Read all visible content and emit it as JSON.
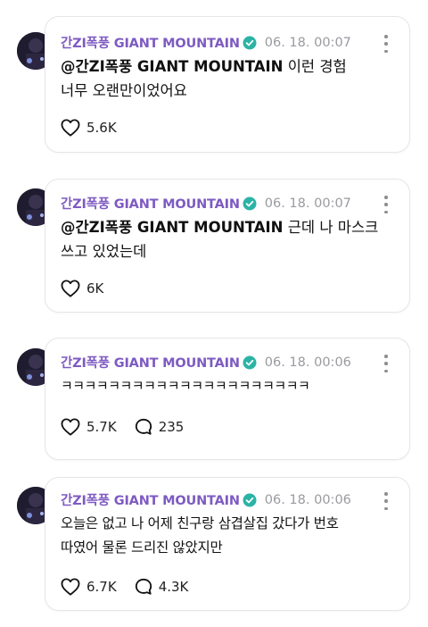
{
  "posts": [
    {
      "author": "간ZI폭풍 GIANT MOUNTAIN",
      "timestamp": "06. 18. 00:07",
      "mention": "@간ZI폭풍 GIANT MOUNTAIN",
      "text_line1": " 이런 경험",
      "text_line2": "너무 오랜만이었어요",
      "likes": "5.6K",
      "comments": null
    },
    {
      "author": "간ZI폭풍 GIANT MOUNTAIN",
      "timestamp": "06. 18. 00:07",
      "mention": "@간ZI폭풍 GIANT MOUNTAIN",
      "text_line1": " 근데 나 마스크",
      "text_line2": "쓰고 있었는데",
      "likes": "6K",
      "comments": null
    },
    {
      "author": "간ZI폭풍 GIANT MOUNTAIN",
      "timestamp": "06. 18. 00:06",
      "mention": "",
      "text_line1": "ㅋㅋㅋㅋㅋㅋㅋㅋㅋㅋㅋㅋㅋㅋㅋㅋㅋㅋㅋㅋㅋ",
      "text_line2": "",
      "likes": "5.7K",
      "comments": "235"
    },
    {
      "author": "간ZI폭풍 GIANT MOUNTAIN",
      "timestamp": "06. 18. 00:06",
      "mention": "",
      "text_line1": "오늘은 없고 나 어제 친구랑 삼겹살집 갔다가 번호",
      "text_line2": "따였어 물론 드리진 않았지만",
      "likes": "6.7K",
      "comments": "4.3K"
    }
  ],
  "colors": {
    "name": "#7e5bc2",
    "badge": "#2bb3a6",
    "time": "#9a9aa0"
  },
  "icons": {
    "badge": "verified-badge-icon",
    "like": "heart-icon",
    "comment": "comment-bubble-icon",
    "more": "more-options-icon"
  }
}
